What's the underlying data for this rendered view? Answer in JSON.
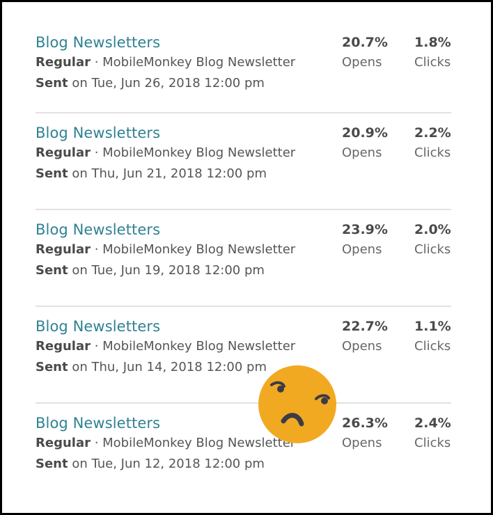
{
  "campaigns": [
    {
      "title": "Blog Newsletters",
      "type_label": "Regular",
      "separator": " · ",
      "list_name": "MobileMonkey Blog Newsletter",
      "status_label": "Sent",
      "date_text": " on Tue, Jun 26, 2018 12:00 pm",
      "opens_value": "20.7%",
      "opens_label": "Opens",
      "clicks_value": "1.8%",
      "clicks_label": "Clicks"
    },
    {
      "title": "Blog Newsletters",
      "type_label": "Regular",
      "separator": " · ",
      "list_name": "MobileMonkey Blog Newsletter",
      "status_label": "Sent",
      "date_text": " on Thu, Jun 21, 2018 12:00 pm",
      "opens_value": "20.9%",
      "opens_label": "Opens",
      "clicks_value": "2.2%",
      "clicks_label": "Clicks"
    },
    {
      "title": "Blog Newsletters",
      "type_label": "Regular",
      "separator": " · ",
      "list_name": "MobileMonkey Blog Newsletter",
      "status_label": "Sent",
      "date_text": " on Tue, Jun 19, 2018 12:00 pm",
      "opens_value": "23.9%",
      "opens_label": "Opens",
      "clicks_value": "2.0%",
      "clicks_label": "Clicks"
    },
    {
      "title": "Blog Newsletters",
      "type_label": "Regular",
      "separator": " · ",
      "list_name": "MobileMonkey Blog Newsletter",
      "status_label": "Sent",
      "date_text": " on Thu, Jun 14, 2018 12:00 pm",
      "opens_value": "22.7%",
      "opens_label": "Opens",
      "clicks_value": "1.1%",
      "clicks_label": "Clicks"
    },
    {
      "title": "Blog Newsletters",
      "type_label": "Regular",
      "separator": " · ",
      "list_name": "MobileMonkey Blog Newsletter",
      "status_label": "Sent",
      "date_text": " on Tue, Jun 12, 2018 12:00 pm",
      "opens_value": "26.3%",
      "opens_label": "Opens",
      "clicks_value": "2.4%",
      "clicks_label": "Clicks"
    }
  ],
  "overlay": {
    "emoji_icon": "frowning-skeptical-face-icon"
  },
  "colors": {
    "title": "#2f8193",
    "emoji_face": "#f2a922",
    "emoji_features": "#3c3b46",
    "divider": "#e2e2e2"
  }
}
